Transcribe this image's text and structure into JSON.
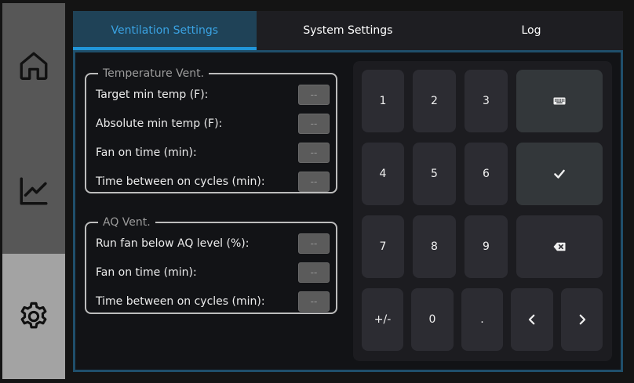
{
  "sidebar": {
    "items": [
      {
        "icon": "home-icon",
        "active": false
      },
      {
        "icon": "chart-line-icon",
        "active": false
      },
      {
        "icon": "gear-icon",
        "active": true
      }
    ]
  },
  "tabs": [
    {
      "label": "Ventilation Settings",
      "active": true
    },
    {
      "label": "System Settings",
      "active": false
    },
    {
      "label": "Log",
      "active": false
    }
  ],
  "temperature_vent": {
    "title": "Temperature Vent.",
    "fields": [
      {
        "label": "Target min temp (F):",
        "value": "--"
      },
      {
        "label": "Absolute min temp (F):",
        "value": "--"
      },
      {
        "label": "Fan on time (min):",
        "value": "--"
      },
      {
        "label": "Time between on cycles (min):",
        "value": "--"
      }
    ]
  },
  "aq_vent": {
    "title": "AQ Vent.",
    "fields": [
      {
        "label": "Run fan below AQ level (%):",
        "value": "--"
      },
      {
        "label": "Fan on time (min):",
        "value": "--"
      },
      {
        "label": "Time between on cycles (min):",
        "value": "--"
      }
    ]
  },
  "keypad": {
    "digits": [
      "1",
      "2",
      "3",
      "4",
      "5",
      "6",
      "7",
      "8",
      "9"
    ],
    "plus_minus": "+/-",
    "zero": "0",
    "dot": ".",
    "icons": {
      "keyboard": "keyboard-icon",
      "confirm": "check-icon",
      "backspace": "backspace-icon",
      "left": "chevron-left-icon",
      "right": "chevron-right-icon"
    }
  },
  "colors": {
    "accent": "#2196d9",
    "active_tab_bg": "#1f4257",
    "sidebar_bg": "#575757",
    "sidebar_active_bg": "#a3a3a3",
    "content_border": "#1f4f6b"
  }
}
